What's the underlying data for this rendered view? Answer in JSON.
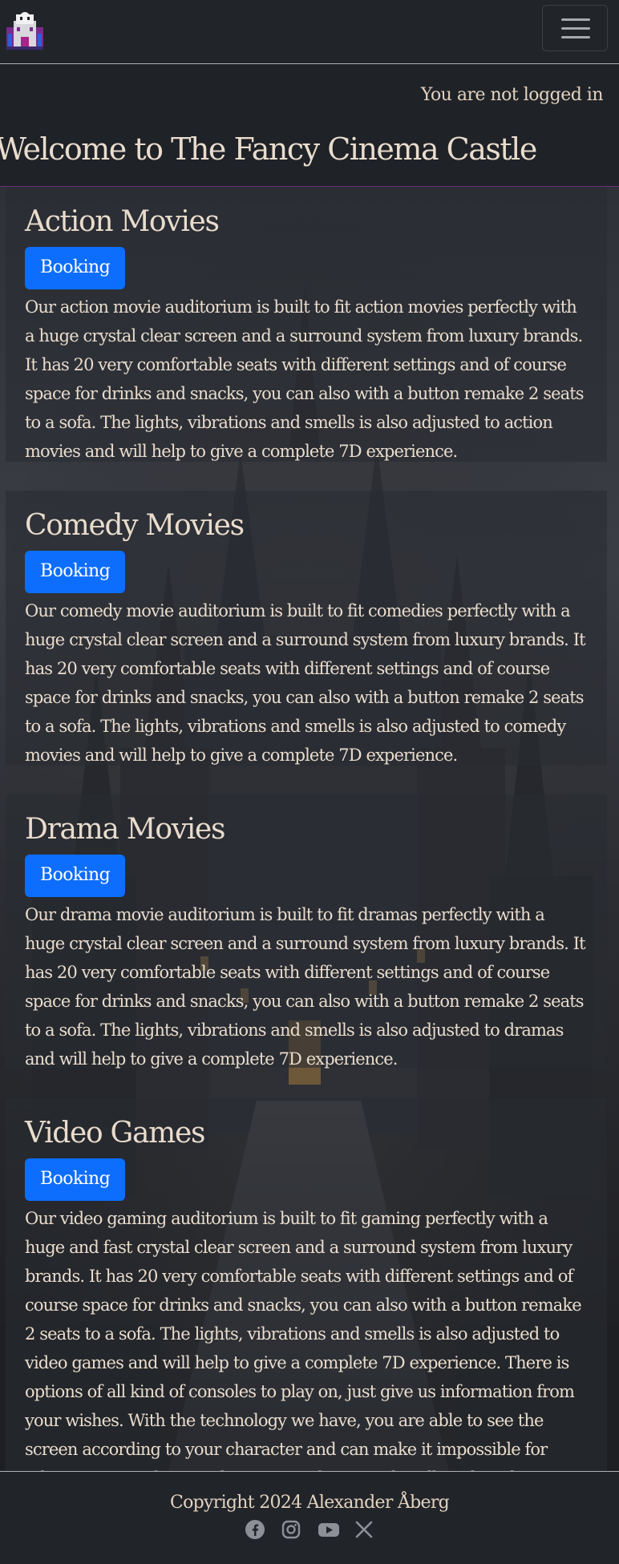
{
  "navbar": {
    "logo_icon": "castle-logo-icon",
    "menu_toggle_icon": "hamburger-menu-icon"
  },
  "login_status": "You are not logged in",
  "welcome_title": "Welcome to The Fancy Cinema Castle",
  "sections": [
    {
      "title": "Action Movies",
      "button_label": "Booking",
      "description": "Our action movie auditorium is built to fit action movies perfectly with a huge crystal clear screen and a surround system from luxury brands. It has 20 very comfortable seats with different settings and of course space for drinks and snacks, you can also with a button remake 2 seats to a sofa. The lights, vibrations and smells is also adjusted to action movies and will help to give a complete 7D experience."
    },
    {
      "title": "Comedy Movies",
      "button_label": "Booking",
      "description": "Our comedy movie auditorium is built to fit comedies perfectly with a huge crystal clear screen and a surround system from luxury brands. It has 20 very comfortable seats with different settings and of course space for drinks and snacks, you can also with a button remake 2 seats to a sofa. The lights, vibrations and smells is also adjusted to comedy movies and will help to give a complete 7D experience."
    },
    {
      "title": "Drama Movies",
      "button_label": "Booking",
      "description": "Our drama movie auditorium is built to fit dramas perfectly with a huge crystal clear screen and a surround system from luxury brands. It has 20 very comfortable seats with different settings and of course space for drinks and snacks, you can also with a button remake 2 seats to a sofa. The lights, vibrations and smells is also adjusted to dramas and will help to give a complete 7D experience."
    },
    {
      "title": "Video Games",
      "button_label": "Booking",
      "description": "Our video gaming auditorium is built to fit gaming perfectly with a huge and fast crystal clear screen and a surround system from luxury brands. It has 20 very comfortable seats with different settings and of course space for drinks and snacks, you can also with a button remake 2 seats to a sofa. The lights, vibrations and smells is also adjusted to video games and will help to give a complete 7D experience. There is options of all kind of consoles to play on, just give us information from your wishes. With the technology we have, you are able to see the screen according to your character and can make it impossible for others to see it if you wish, you can of course also allow the other players to see your \"screen\"."
    }
  ],
  "footer": {
    "copyright": "Copyright 2024 Alexander Åberg",
    "social_icons": [
      "facebook-icon",
      "instagram-icon",
      "youtube-icon",
      "x-icon"
    ]
  },
  "colors": {
    "navbar_bg": "#212429",
    "page_bg": "#1f2227",
    "text": "#e9dccd",
    "button_bg": "#0d6efd",
    "accent_divider": "#6b2f7a"
  }
}
